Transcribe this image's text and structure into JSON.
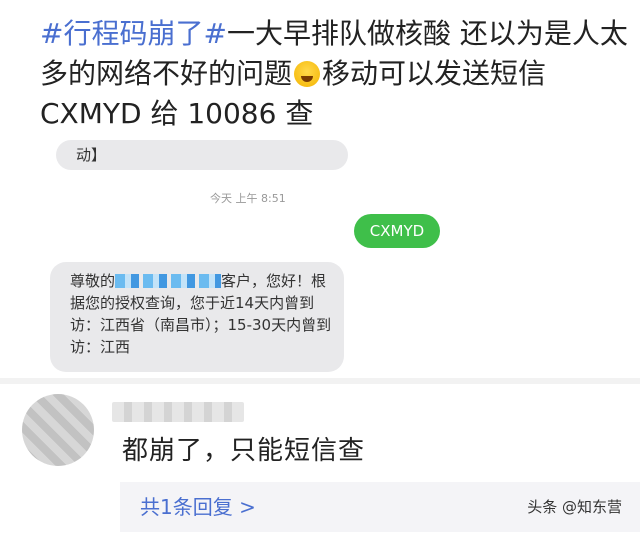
{
  "post": {
    "hashtag": "#行程码崩了#",
    "text_a": "一大早排队做核酸 还以为是人太多的网络不好的问题",
    "text_b": "移动可以发送短信 CXMYD 给 10086 查",
    "emoji_icon": "crying-laughing-emoji"
  },
  "sms": {
    "prev_message_tail": "动】",
    "timestamp": "今天 上午 8:51",
    "sent_message": "CXMYD",
    "reply_prefix": "尊敬的",
    "reply_suffix": "客户，您好！根据您的授权查询，您于近14天内曾到访：江西省（南昌市）；15-30天内曾到访：江西"
  },
  "comment": {
    "text": "都崩了，只能短信查",
    "replies_link": "共1条回复 >",
    "watermark": "头条 @知东营"
  }
}
